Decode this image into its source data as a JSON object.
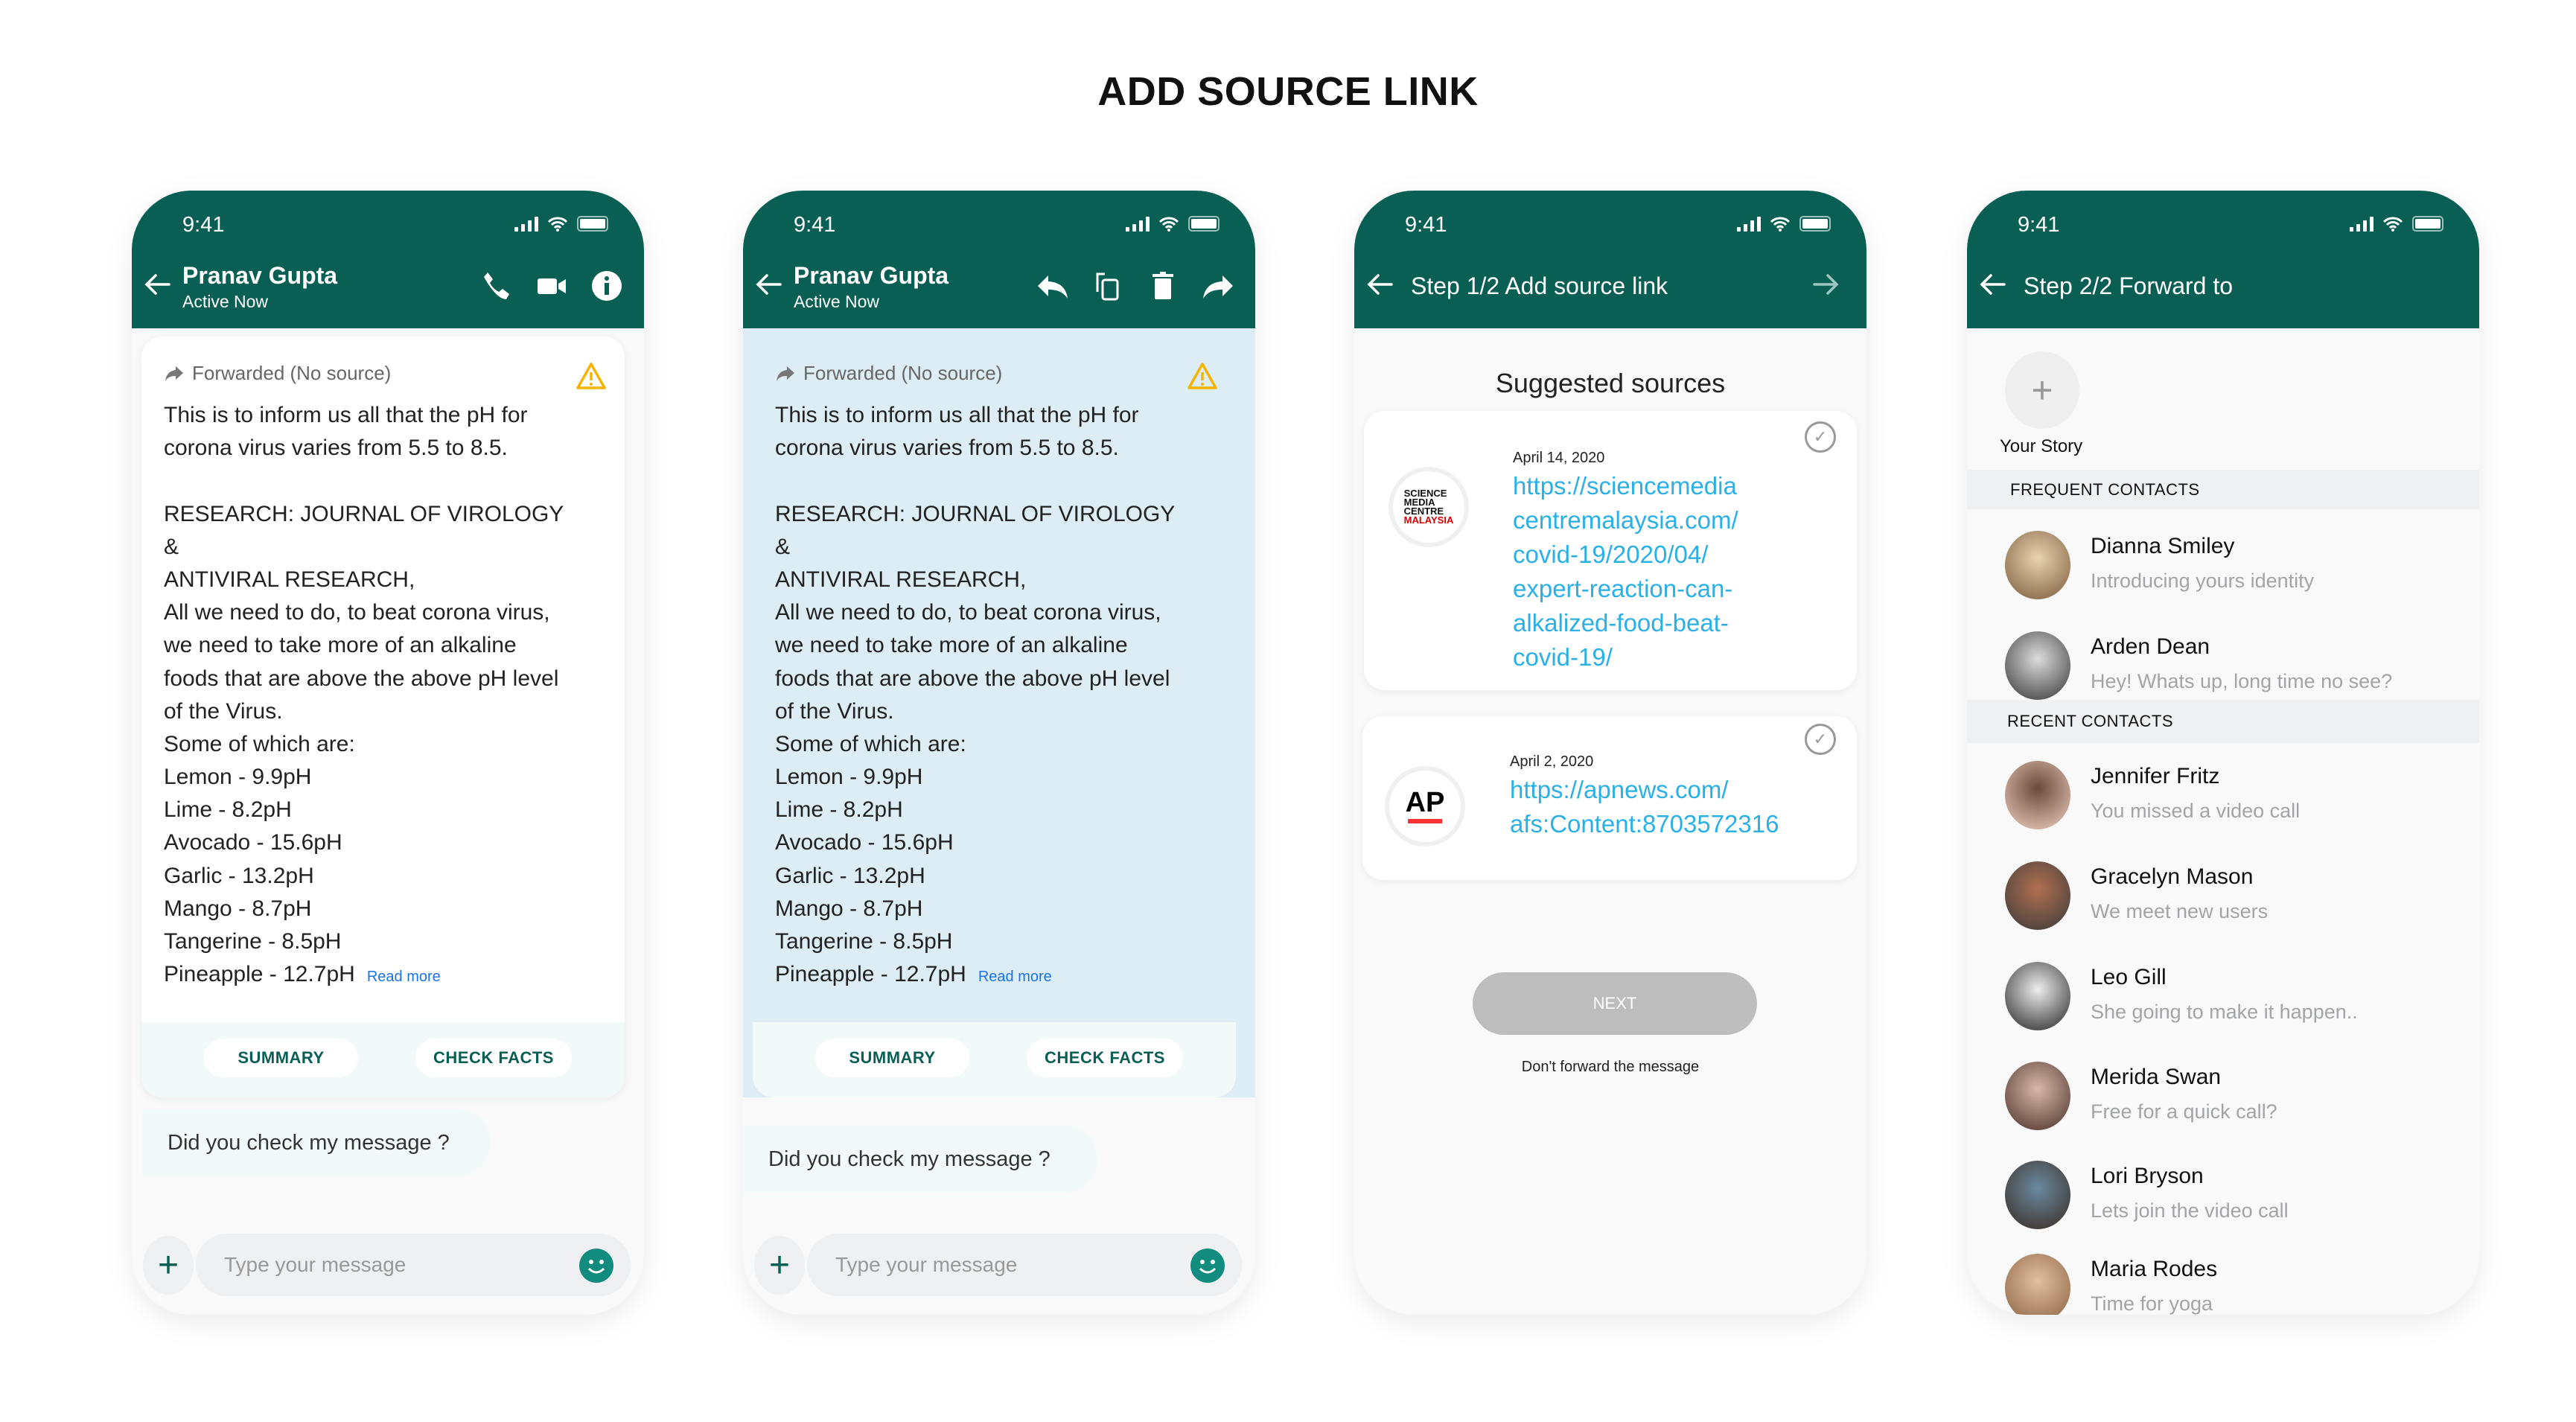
{
  "page_title": "ADD SOURCE LINK",
  "status_time": "9:41",
  "chat": {
    "contact_name": "Pranav Gupta",
    "contact_status": "Active Now",
    "forwarded_label": "Forwarded (No source)",
    "message_lines": [
      "This is to inform us all that the pH for",
      "corona virus varies from 5.5 to 8.5.",
      "",
      "RESEARCH: JOURNAL OF VIROLOGY",
      "&",
      "ANTIVIRAL RESEARCH,",
      "All we need to do, to beat corona virus,",
      "we need to take more of an alkaline",
      "foods that are above the above pH level",
      "of the Virus.",
      "Some of which are:",
      "Lemon - 9.9pH",
      "Lime - 8.2pH",
      "Avocado - 15.6pH",
      "Garlic - 13.2pH",
      "Mango - 8.7pH",
      "Tangerine - 8.5pH",
      "Pineapple - 12.7pH"
    ],
    "read_more": "Read more",
    "summary_button": "SUMMARY",
    "check_facts_button": "CHECK FACTS",
    "reply_message": "Did you check my message ?",
    "input_placeholder": "Type your message"
  },
  "step1": {
    "header": "Step 1/2 Add source link",
    "section_title": "Suggested sources",
    "sources": [
      {
        "date": "April 14, 2020",
        "url_lines": [
          "https://sciencemedia",
          "centremalaysia.com/",
          "covid-19/2020/04/",
          "expert-reaction-can-",
          "alkalized-food-beat-",
          "covid-19/"
        ],
        "logo": "SCIENCE MEDIA CENTRE MALAYSIA"
      },
      {
        "date": "April 2, 2020",
        "url_lines": [
          "https://apnews.com/",
          "afs:Content:8703572316"
        ],
        "logo": "AP"
      }
    ],
    "next_button": "NEXT",
    "dont_forward": "Don't forward the message"
  },
  "step2": {
    "header": "Step 2/2 Forward to",
    "your_story": "Your Story",
    "frequent_label": "FREQUENT CONTACTS",
    "recent_label": "RECENT CONTACTS",
    "frequent": [
      {
        "name": "Dianna Smiley",
        "message": "Introducing yours identity"
      },
      {
        "name": "Arden Dean",
        "message": "Hey! Whats up, long time no see?"
      }
    ],
    "recent": [
      {
        "name": "Jennifer Fritz",
        "message": "You missed a video call"
      },
      {
        "name": "Gracelyn Mason",
        "message": "We meet new users"
      },
      {
        "name": "Leo Gill",
        "message": "She going to make it happen.."
      },
      {
        "name": "Merida Swan",
        "message": "Free for a quick call?"
      },
      {
        "name": "Lori Bryson",
        "message": "Lets join the video call"
      },
      {
        "name": "Maria Rodes",
        "message": "Time for yoga"
      }
    ]
  },
  "colors": {
    "brand": "#0a5f55",
    "link": "#2bb0e6",
    "warning": "#f5b400"
  }
}
